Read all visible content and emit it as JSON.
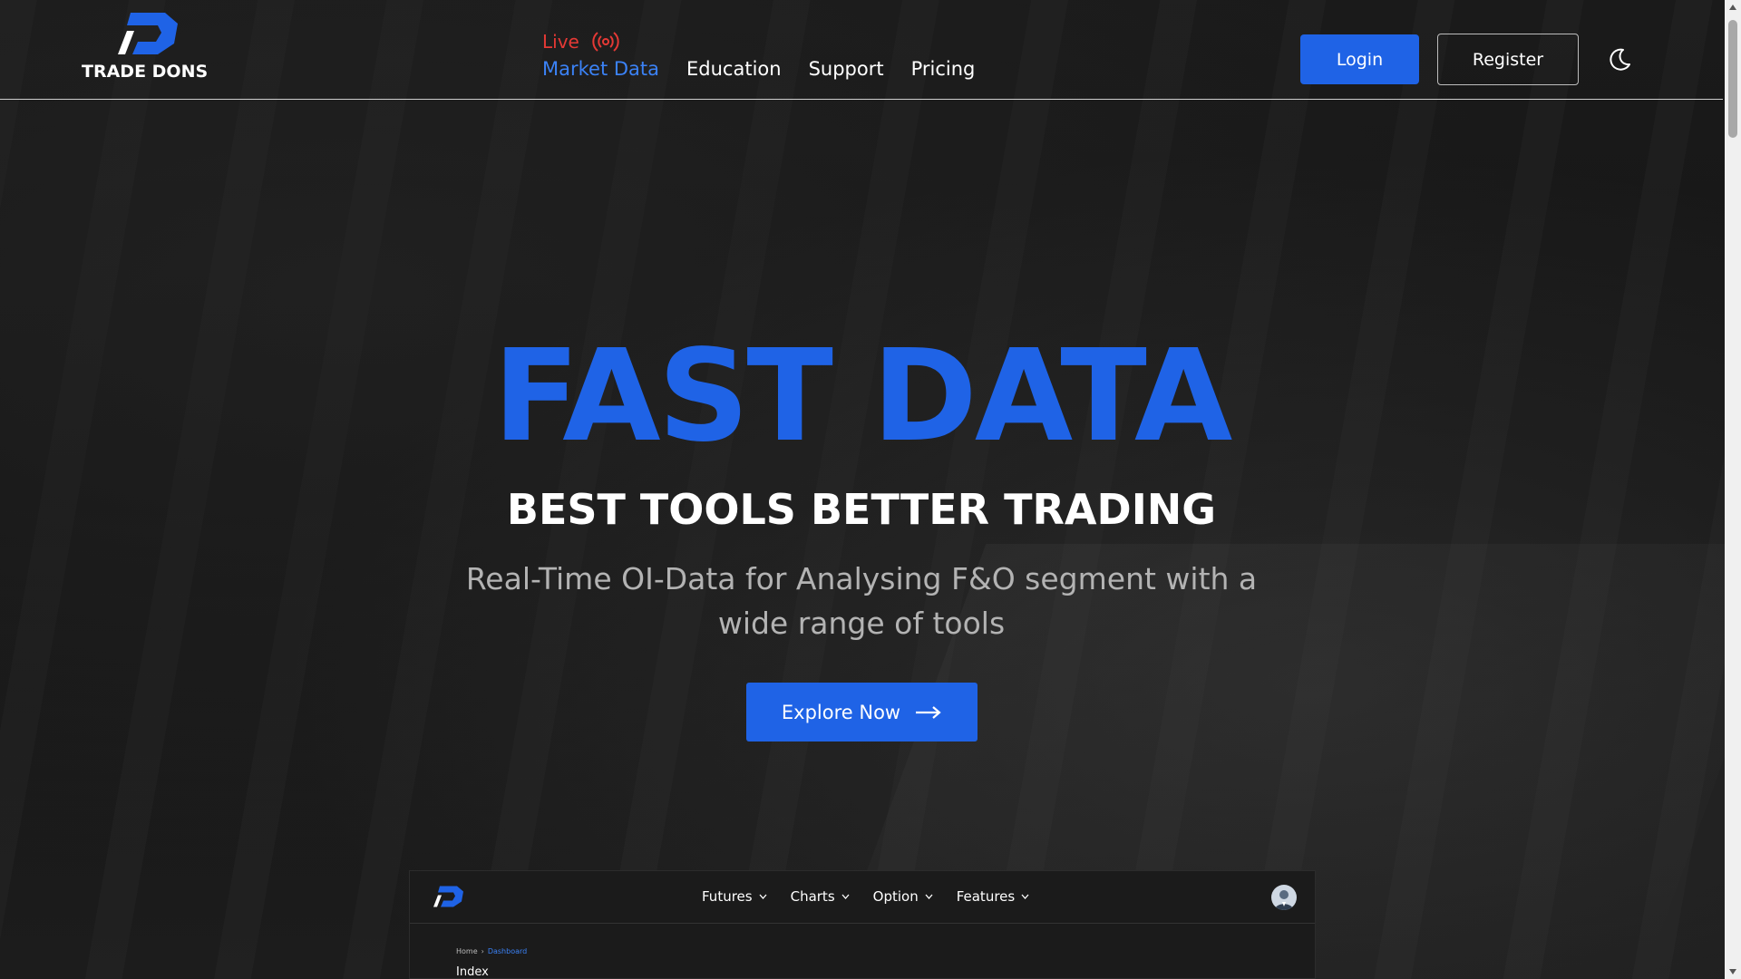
{
  "brand": {
    "name": "TRADE DONS",
    "accent": "#1f63e6"
  },
  "nav": {
    "live_label": "Live",
    "links": [
      {
        "label": "Market Data",
        "active": true
      },
      {
        "label": "Education",
        "active": false
      },
      {
        "label": "Support",
        "active": false
      },
      {
        "label": "Pricing",
        "active": false
      }
    ],
    "login_label": "Login",
    "register_label": "Register",
    "theme_icon": "moon-icon"
  },
  "hero": {
    "title": "FAST DATA",
    "subtitle": "BEST TOOLS BETTER TRADING",
    "description": "Real-Time OI-Data for Analysing F&O segment with a wide range of tools",
    "cta_label": "Explore Now",
    "cta_icon": "arrow-right-icon"
  },
  "preview": {
    "menu": [
      {
        "label": "Futures"
      },
      {
        "label": "Charts"
      },
      {
        "label": "Option"
      },
      {
        "label": "Features"
      }
    ],
    "breadcrumb": {
      "home": "Home",
      "current": "Dashboard"
    },
    "section_title": "Index"
  }
}
